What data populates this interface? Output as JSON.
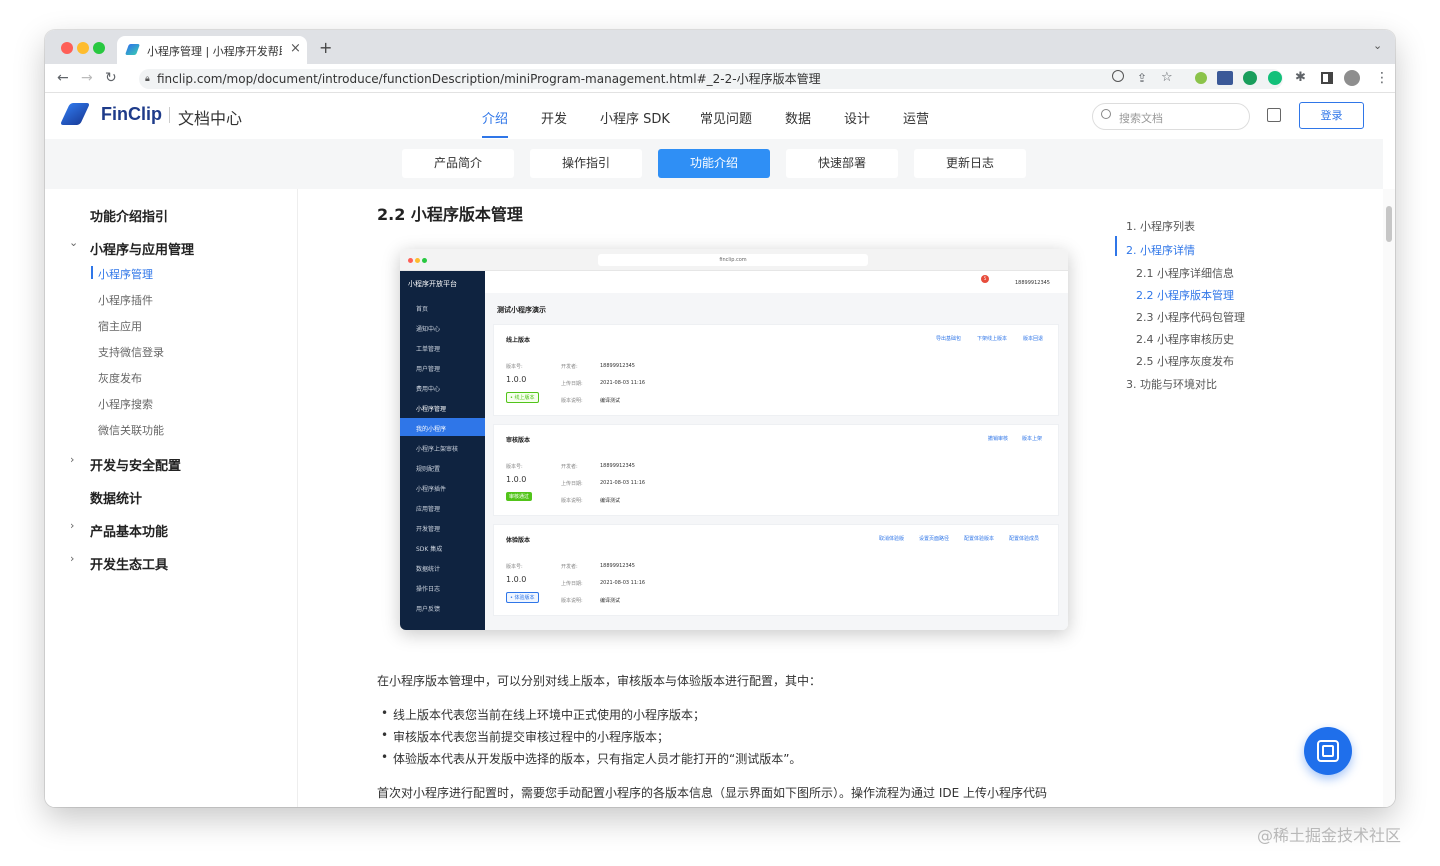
{
  "browser": {
    "tab_title": "小程序管理 | 小程序开发帮助中心",
    "tab_close": "×",
    "new_tab": "+",
    "url": "finclip.com/mop/document/introduce/functionDescription/miniProgram-management.html#_2-2-小程序版本管理"
  },
  "header": {
    "logo": "FinClip",
    "site": "文档中心",
    "nav": [
      "介绍",
      "开发",
      "小程序 SDK",
      "常见问题",
      "数据",
      "设计",
      "运营"
    ],
    "search_placeholder": "搜索文档",
    "login": "登录"
  },
  "subtabs": [
    "产品简介",
    "操作指引",
    "功能介绍",
    "快速部署",
    "更新日志"
  ],
  "sidebar": {
    "title": "功能介绍指引",
    "group": "小程序与应用管理",
    "items": [
      "小程序管理",
      "小程序插件",
      "宿主应用",
      "支持微信登录",
      "灰度发布",
      "小程序搜索",
      "微信关联功能"
    ],
    "sections": [
      "开发与安全配置",
      "数据统计",
      "产品基本功能",
      "开发生态工具"
    ]
  },
  "main": {
    "heading": "2.2 小程序版本管理",
    "intro": "在小程序版本管理中，可以分别对线上版本，审核版本与体验版本进行配置，其中：",
    "bullets": [
      "线上版本代表您当前在线上环境中正式使用的小程序版本；",
      "审核版本代表您当前提交审核过程中的小程序版本；",
      "体验版本代表从开发版中选择的版本，只有指定人员才能打开的“测试版本”。"
    ],
    "footer_text": "首次对小程序进行配置时，需要您手动配置小程序的各版本信息（显示界面如下图所示）。操作流程为通过 IDE 上传小程序代码"
  },
  "toc": {
    "items": [
      "1. 小程序列表",
      "2. 小程序详情",
      "2.1 小程序详细信息",
      "2.2 小程序版本管理",
      "2.3 小程序代码包管理",
      "2.4 小程序审核历史",
      "2.5 小程序灰度发布",
      "3. 功能与环境对比"
    ]
  },
  "screenshot": {
    "url": "finclip.com",
    "platform": "小程序开放平台",
    "account": "18899912345",
    "notice_count": "5",
    "menu": [
      "首页",
      "通知中心",
      "工单管理",
      "用户管理",
      "费用中心",
      "小程序管理",
      "我的小程序",
      "小程序上架审核",
      "规则配置",
      "小程序插件",
      "应用管理",
      "开发管理",
      "SDK 集成",
      "数据统计",
      "操作日志",
      "用户反馈"
    ],
    "page_title": "测试小程序演示",
    "labels": {
      "version_no": "版本号:",
      "developer": "开发者:",
      "upload_date": "上传日期:",
      "description": "版本说明:"
    },
    "cards": [
      {
        "title": "线上版本",
        "actions": [
          "导出基础包",
          "下架线上版本",
          "版本回退"
        ],
        "version": "1.0.0",
        "developer": "18899912345",
        "date": "2021-08-03 11:16",
        "desc": "编译测试",
        "badge": "• 线上版本"
      },
      {
        "title": "审核版本",
        "actions": [
          "撤销审核",
          "版本上架"
        ],
        "version": "1.0.0",
        "developer": "18899912345",
        "date": "2021-08-03 11:16",
        "desc": "编译测试",
        "badge": "审核通过"
      },
      {
        "title": "体验版本",
        "actions": [
          "取消体验版",
          "设置页面路径",
          "配置体验版本",
          "配置体验成员"
        ],
        "version": "1.0.0",
        "developer": "18899912345",
        "date": "2021-08-03 11:16",
        "desc": "编译测试",
        "badge": "• 体验版本"
      }
    ]
  },
  "watermark": "@稀土掘金技术社区",
  "colors": {
    "accent": "#2f76e8",
    "sidebar_dark": "#0f2340",
    "fab": "#1f6feb"
  }
}
